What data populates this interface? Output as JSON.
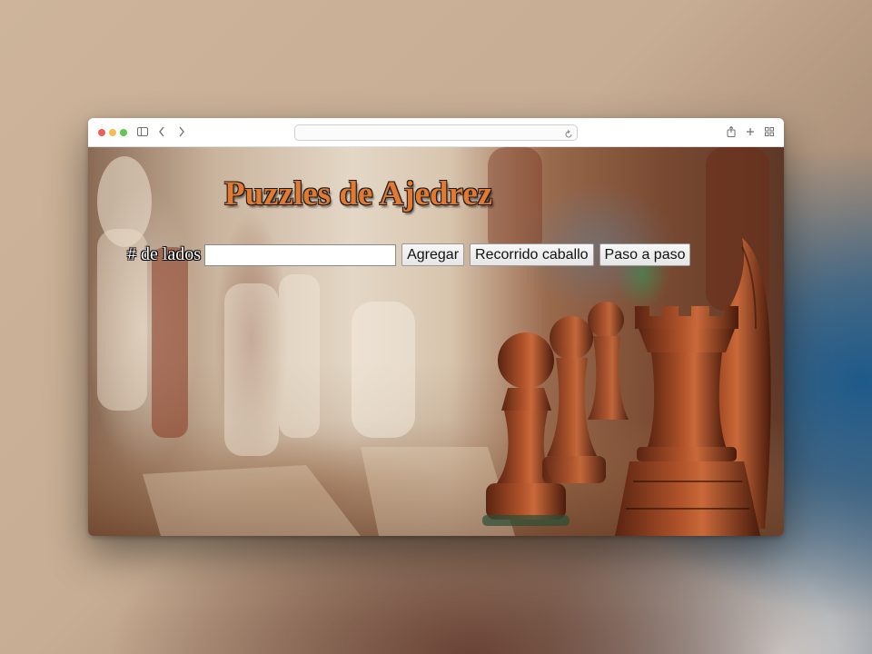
{
  "browser": {
    "address": "",
    "icons": [
      "sidebar-icon",
      "back-icon",
      "forward-icon",
      "reload-icon",
      "share-icon",
      "new-tab-icon",
      "tabs-overview-icon"
    ]
  },
  "page": {
    "title": "Puzzles de Ajedrez",
    "sides_label": "# de lados",
    "sides_value": "",
    "buttons": {
      "add": "Agregar",
      "knight_tour": "Recorrido caballo",
      "step_by_step": "Paso a paso"
    }
  },
  "colors": {
    "title": "#e3782f",
    "title_outline": "#1a1a1a"
  }
}
